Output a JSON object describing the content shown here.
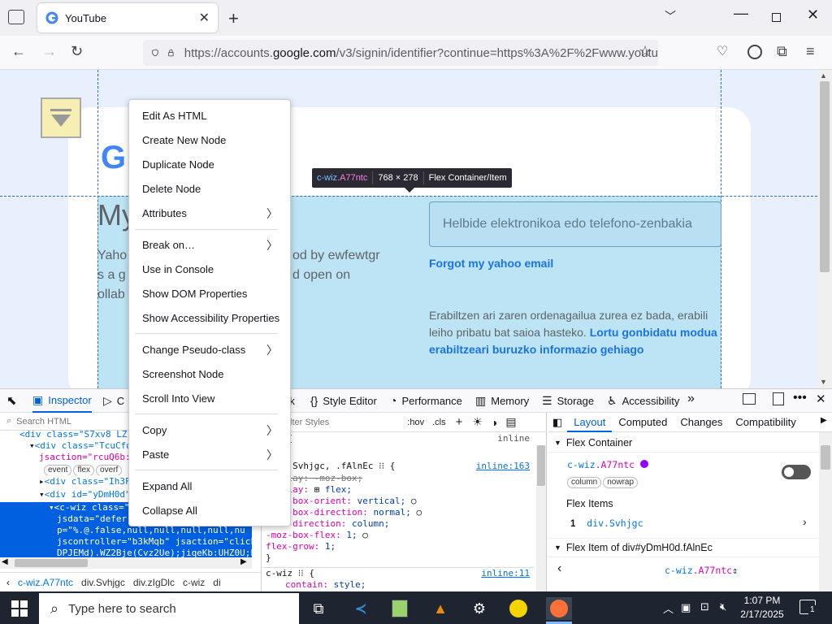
{
  "browser": {
    "tab_title": "YouTube",
    "url_prefix": "https://accounts.",
    "url_host": "google.com",
    "url_rest": "/v3/signin/identifier?continue=https%3A%2F%2Fwww.youtu"
  },
  "page": {
    "heading_partial": "My",
    "bg_left_lines": [
      "Yaho",
      "s a g",
      "ollab"
    ],
    "bg_right_lines": [
      "od by ewfewtgr",
      "d open on"
    ],
    "email_placeholder": "Helbide elektronikoa edo telefono-zenbakia",
    "forgot_link": "Forgot my yahoo email",
    "help_text": "Erabiltzen ari zaren ordenagailua zurea ez bada, erabili leiho pribatu bat saioa hasteko.",
    "help_link": "Lortu gonbidatu modua erabiltzeari buruzko informazio gehiago"
  },
  "tooltip": {
    "tag": "c-wiz",
    "cls": ".A77ntc",
    "size": "768 × 278",
    "kind": "Flex Container/Item"
  },
  "context_menu": {
    "items": [
      "Edit As HTML",
      "Create New Node",
      "Duplicate Node",
      "Delete Node",
      "Attributes",
      "Break on…",
      "Use in Console",
      "Show DOM Properties",
      "Show Accessibility Properties",
      "Change Pseudo-class",
      "Screenshot Node",
      "Scroll Into View",
      "Copy",
      "Paste",
      "Expand All",
      "Collapse All"
    ]
  },
  "devtools": {
    "tabs": [
      "Inspector",
      "C",
      "rk",
      "Style Editor",
      "Performance",
      "Memory",
      "Storage",
      "Accessibility"
    ],
    "search_placeholder": "Search HTML",
    "rules_filter": "lter Styles",
    "rules_hov": ":hov",
    "rules_cls": ".cls",
    "html_lines": [
      "<div class=\"S7xv8 LZ",
      "<div class=\"TcuCfd",
      "jsaction=\"rcuQ6b:np",
      "<div class=\"Ih3FE",
      "<div id=\"yDmH0d\"",
      "<c-wiz class=\"A",
      "jsdata=\"deferre",
      "p=\"%.@.false,null,null,null,null,nu",
      "jscontroller=\"b3kMqb\" jsaction=\"click:JI",
      "DPJEMd).WZ2Bje(Cvz2Ue);jiqeKb:UHZ0U;Pp1"
    ],
    "badges": [
      "event",
      "flex",
      "overf"
    ],
    "breadcrumbs": [
      "c-wiz.A77ntc",
      "div.Svhjgc",
      "div.zIgDlc",
      "c-wiz",
      "di"
    ],
    "css": {
      "line1_sel": "ent",
      "line1_src": "inline",
      "rule_sel": "tc, .Svhjgc, .fAlnEc",
      "rule_src": "inline:163",
      "p1": "display: -moz-box;",
      "p2": "display:",
      "p2v": "flex;",
      "p3": "-moz-box-orient:",
      "p3v": "vertical;",
      "p4": "-moz-box-direction:",
      "p4v": "normal;",
      "p5": "flex-direction:",
      "p5v": "column;",
      "p6": "-moz-box-flex:",
      "p6v": "1;",
      "p7": "flex-grow:",
      "p7v": "1;",
      "close": "}",
      "rule2_sel": "c-wiz",
      "rule2_src": "inline:11",
      "p8": "contain:",
      "p8v": "style;"
    },
    "layout_tabs": [
      "Layout",
      "Computed",
      "Changes",
      "Compatibility"
    ],
    "flex_container_label": "Flex Container",
    "flex_container_el_tag": "c-wiz",
    "flex_container_el_cls": ".A77ntc",
    "flex_badges": [
      "column",
      "nowrap"
    ],
    "flex_items_label": "Flex Items",
    "flex_item_num": "1",
    "flex_item_name": "div.Svhjgc",
    "flex_item_of": "Flex Item of div#yDmH0d.fAlnEc",
    "flex_item_nav_tag": "c-wiz",
    "flex_item_nav_cls": ".A77ntc"
  },
  "taskbar": {
    "search_placeholder": "Type here to search",
    "time": "1:07 PM",
    "date": "2/17/2025",
    "notif_count": "1"
  }
}
